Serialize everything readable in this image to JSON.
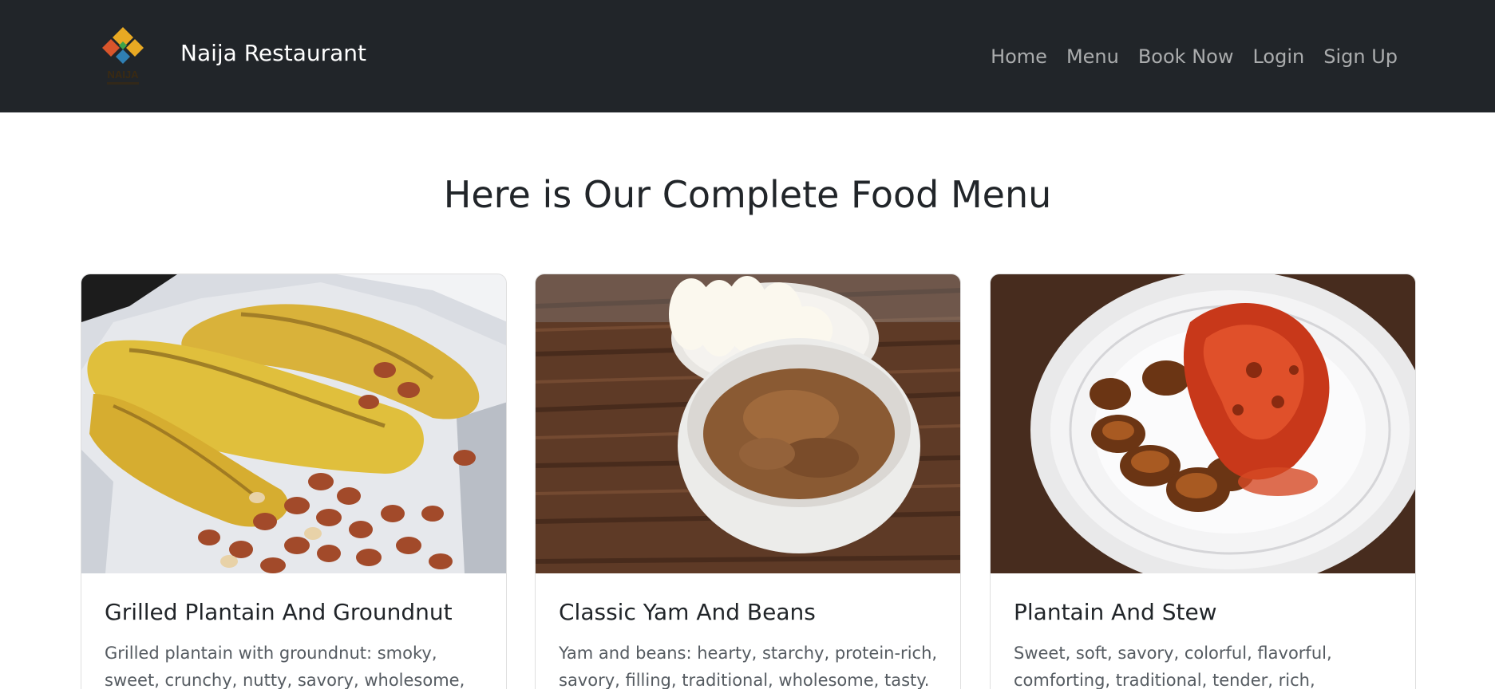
{
  "navbar": {
    "brand": "Naija Restaurant",
    "logo_text": "NAIJA",
    "links": [
      "Home",
      "Menu",
      "Book Now",
      "Login",
      "Sign Up"
    ]
  },
  "main": {
    "title": "Here is Our Complete Food Menu"
  },
  "menu_items": [
    {
      "title": "Grilled Plantain And Groundnut",
      "description": "Grilled plantain with groundnut: smoky, sweet, crunchy, nutty, savory, wholesome, flavorful.",
      "image": "grilled-plantain-photo"
    },
    {
      "title": "Classic Yam And Beans",
      "description": "Yam and beans: hearty, starchy, protein-rich, savory, filling, traditional, wholesome, tasty.",
      "image": "yam-and-beans-photo"
    },
    {
      "title": "Plantain And Stew",
      "description": "Sweet, soft, savory, colorful, flavorful, comforting, traditional, tender, rich, satisfying.",
      "image": "plantain-and-stew-photo"
    }
  ],
  "colors": {
    "navbar_bg": "#212529",
    "nav_link": "rgba(255,255,255,0.62)",
    "brand_text": "#ffffff",
    "heading": "#212529",
    "body_text": "#555b61"
  }
}
